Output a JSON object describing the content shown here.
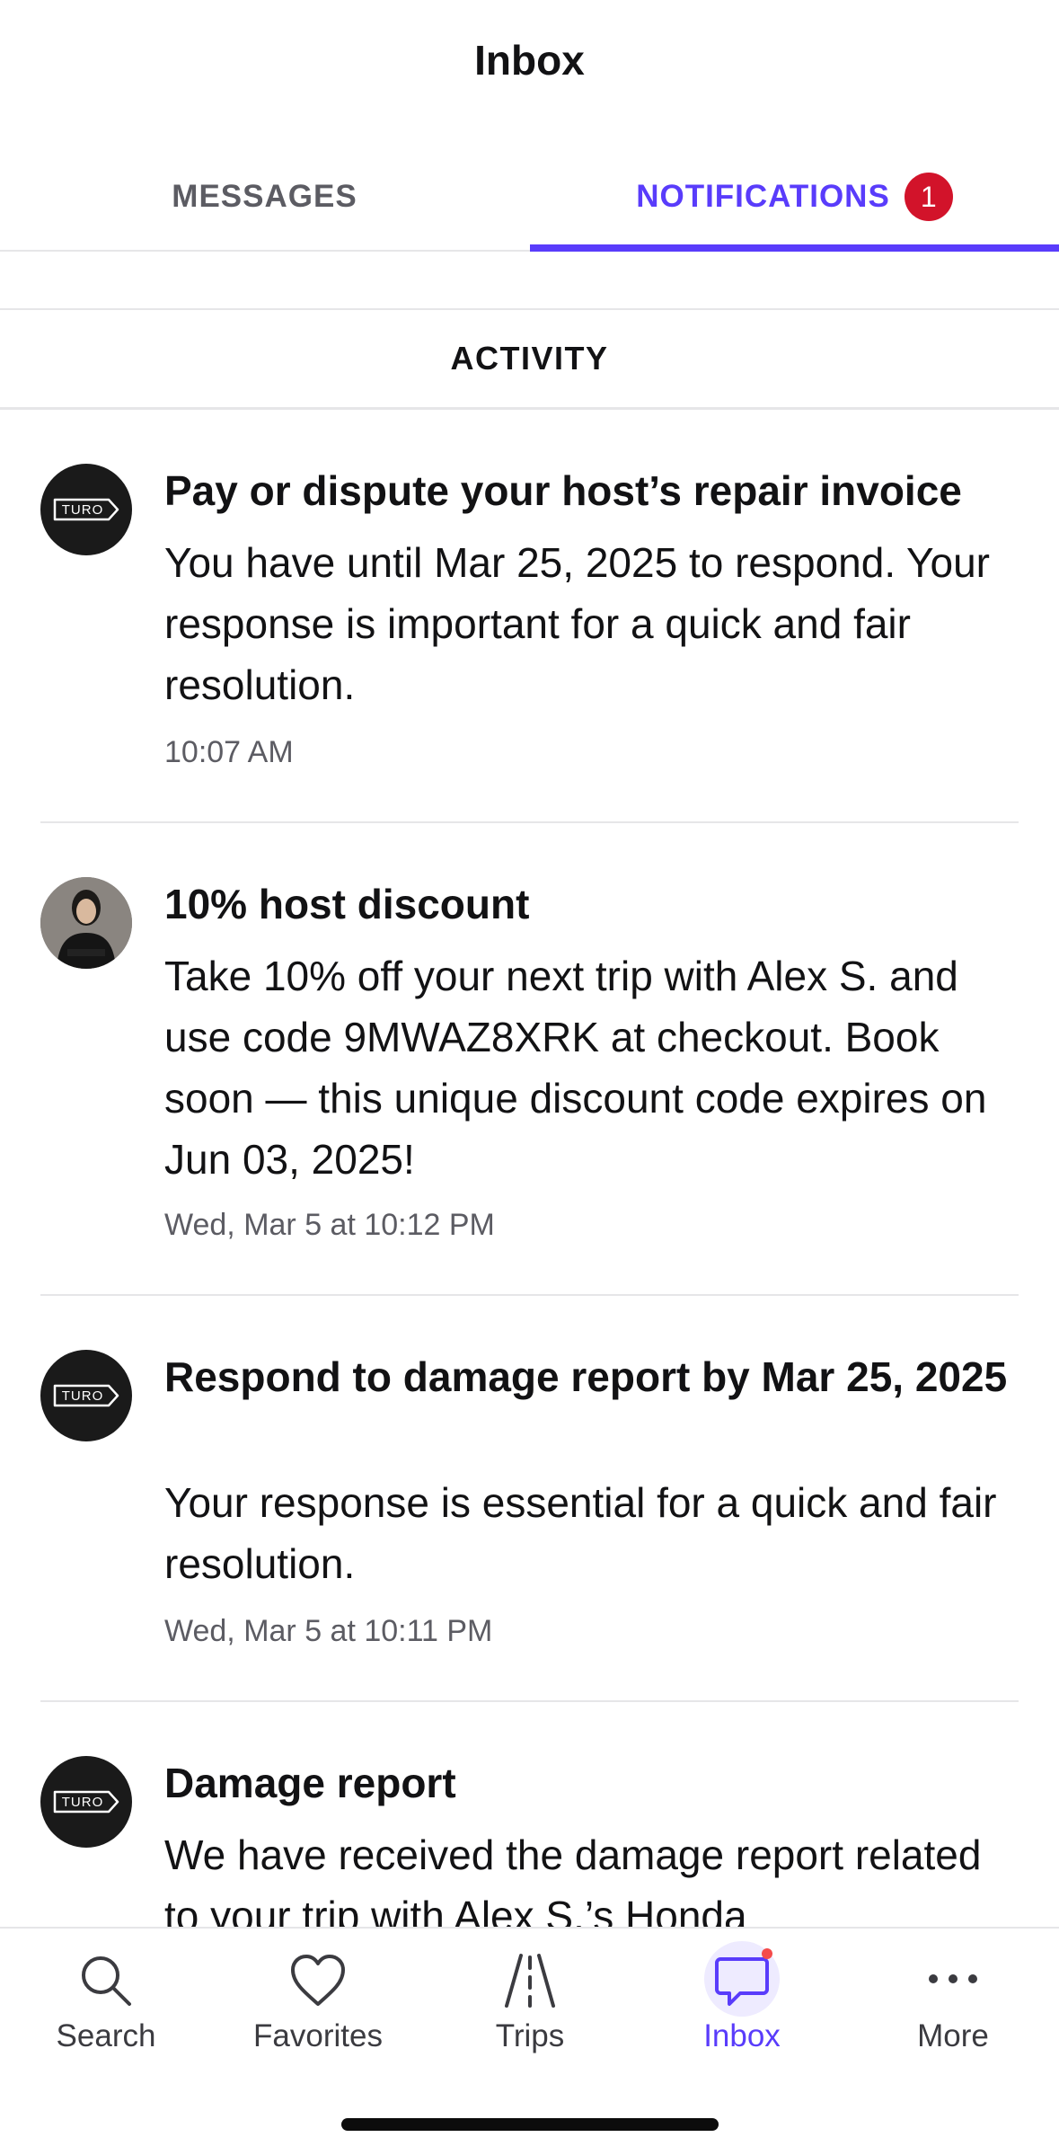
{
  "header": {
    "title": "Inbox"
  },
  "tabs": {
    "messages_label": "MESSAGES",
    "notifications_label": "NOTIFICATIONS",
    "notifications_badge": "1",
    "active": "notifications"
  },
  "section": {
    "title": "ACTIVITY"
  },
  "notifications": [
    {
      "avatar": "turo-logo",
      "avatar_text": "TURO",
      "title": "Pay or dispute your host’s repair invoice",
      "body": "You have until Mar 25, 2025 to respond. Your response is important for a quick and fair resolution.",
      "time": "10:07 AM"
    },
    {
      "avatar": "host-photo",
      "title": "10% host discount",
      "body": "Take 10% off your next trip with Alex S. and use code 9MWAZ8XRK at checkout. Book soon — this unique discount code expires on Jun 03, 2025!",
      "time": "Wed, Mar 5 at 10:12 PM"
    },
    {
      "avatar": "turo-logo",
      "avatar_text": "TURO",
      "title": "Respond to damage report by Mar 25, 2025",
      "body": "Your response is essential for a quick and fair resolution.",
      "time": "Wed, Mar 5 at 10:11 PM"
    },
    {
      "avatar": "turo-logo",
      "avatar_text": "TURO",
      "title": "Damage report",
      "body": "We have received the damage report related to your trip with Alex S.’s Honda",
      "time": ""
    }
  ],
  "bottom_nav": {
    "items": [
      {
        "label": "Search",
        "icon": "search-icon"
      },
      {
        "label": "Favorites",
        "icon": "heart-icon"
      },
      {
        "label": "Trips",
        "icon": "road-icon"
      },
      {
        "label": "Inbox",
        "icon": "chat-bubble-icon",
        "active": true,
        "dot": true
      },
      {
        "label": "More",
        "icon": "more-dots-icon"
      }
    ]
  },
  "colors": {
    "accent": "#593cfb",
    "badge": "#d2132a",
    "text": "#121214",
    "secondary_text": "#5c5c63",
    "divider": "#e6e6e8",
    "dot": "#f44b4b"
  }
}
